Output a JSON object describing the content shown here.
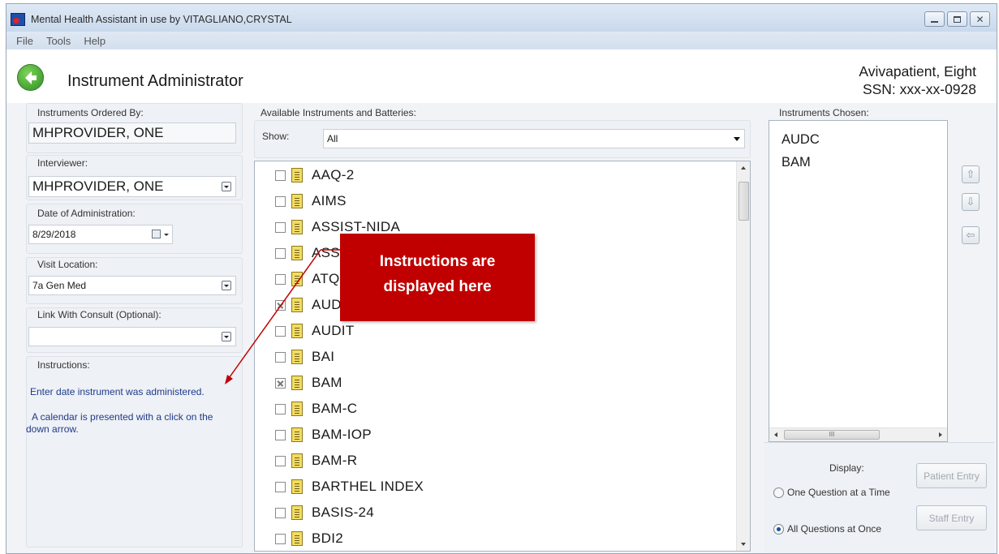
{
  "window": {
    "title": "Mental Health Assistant in use by VITAGLIANO,CRYSTAL",
    "buttons": {
      "minimize": "minimize-icon",
      "maximize": "maximize-icon",
      "close": "close-icon"
    }
  },
  "menu": [
    "File",
    "Tools",
    "Help"
  ],
  "header": {
    "title": "Instrument Administrator",
    "patient_name": "Avivapatient, Eight",
    "patient_ssn": "SSN: xxx-xx-0928"
  },
  "left": {
    "ordered_by": {
      "label": "Instruments Ordered By:",
      "value": "MHPROVIDER, ONE"
    },
    "interviewer": {
      "label": "Interviewer:",
      "value": "MHPROVIDER, ONE"
    },
    "date": {
      "label": "Date of Administration:",
      "value": "8/29/2018"
    },
    "location": {
      "label": "Visit Location:",
      "value": "7a Gen Med"
    },
    "consult": {
      "label": "Link With Consult (Optional):",
      "value": ""
    },
    "instructions": {
      "label": "Instructions:",
      "line1": "Enter date instrument was administered.",
      "line2a": "A calendar is presented with a click on the",
      "line2b": "down arrow."
    }
  },
  "available": {
    "label": "Available Instruments and Batteries:",
    "show_label": "Show:",
    "show_value": "All",
    "items": [
      {
        "name": "AAQ-2",
        "checked": false
      },
      {
        "name": "AIMS",
        "checked": false
      },
      {
        "name": "ASSIST-NIDA",
        "checked": false
      },
      {
        "name": "ASSIST-WHO",
        "checked": false
      },
      {
        "name": "ATQ",
        "checked": false
      },
      {
        "name": "AUDC",
        "checked": true
      },
      {
        "name": "AUDIT",
        "checked": false
      },
      {
        "name": "BAI",
        "checked": false
      },
      {
        "name": "BAM",
        "checked": true
      },
      {
        "name": "BAM-C",
        "checked": false
      },
      {
        "name": "BAM-IOP",
        "checked": false
      },
      {
        "name": "BAM-R",
        "checked": false
      },
      {
        "name": "BARTHEL INDEX",
        "checked": false
      },
      {
        "name": "BASIS-24",
        "checked": false
      },
      {
        "name": "BDI2",
        "checked": false
      }
    ]
  },
  "chosen": {
    "label": "Instruments Chosen:",
    "items": [
      "AUDC",
      "BAM"
    ],
    "scroll_marker": "III"
  },
  "display": {
    "label": "Display:",
    "option_one": "One Question at a Time",
    "option_all": "All Questions at Once",
    "selected": "All Questions at Once",
    "patient_entry": "Patient Entry",
    "staff_entry": "Staff Entry"
  },
  "callout": {
    "line1": "Instructions are",
    "line2": "displayed here",
    "color": "#c00000"
  }
}
